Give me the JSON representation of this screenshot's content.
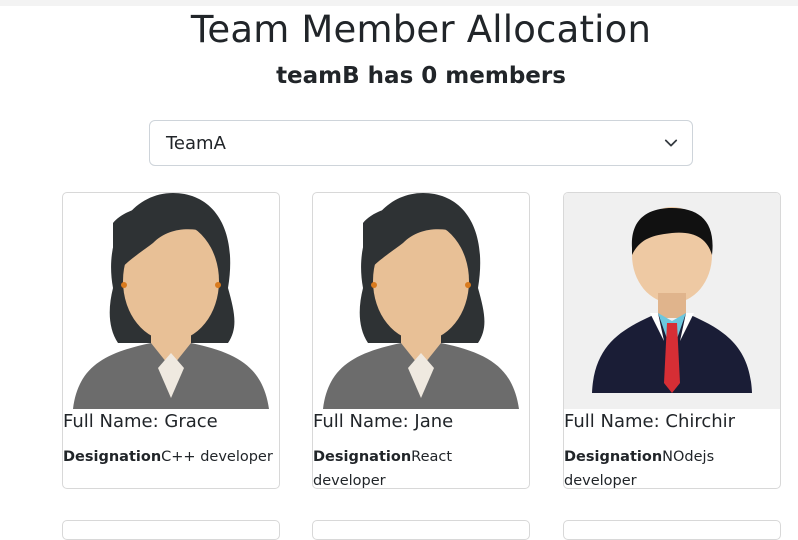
{
  "header": {
    "title": "Team Member Allocation",
    "subtitle": "teamB has 0 members"
  },
  "team_select": {
    "selected": "TeamA",
    "icon": "chevron-down-icon"
  },
  "cards": [
    {
      "name": "Full Name: Grace",
      "designation_label": "Designation",
      "designation": "C++ developer",
      "avatar": "female-avatar-icon"
    },
    {
      "name": "Full Name: Jane",
      "designation_label": "Designation",
      "designation": "React developer",
      "avatar": "female-avatar-icon"
    },
    {
      "name": "Full Name: Chirchir",
      "designation_label": "Designation",
      "designation": "NOdejs developer",
      "avatar": "male-avatar-icon"
    }
  ]
}
